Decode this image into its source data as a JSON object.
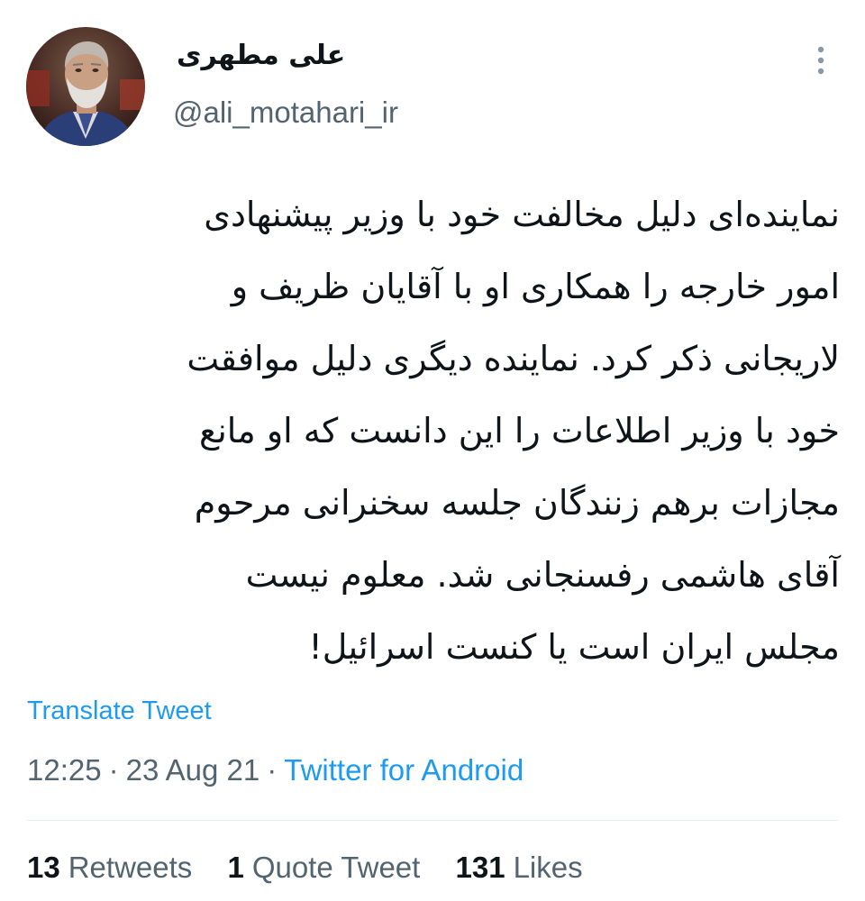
{
  "colors": {
    "link": "#1d9bf0",
    "secondary_text": "#536471",
    "primary_text": "#0f1419",
    "divider": "#e6ecf0"
  },
  "author": {
    "display_name": "علی مطهری",
    "handle": "@ali_motahari_ir",
    "avatar_icon": "profile-photo"
  },
  "menu": {
    "icon": "more-vertical-icon"
  },
  "tweet": {
    "lines": [
      "نماینده‌ای دلیل مخالفت خود با وزیر پیشنهادی",
      "امور خارجه را همکاری او با آقایان ظریف و",
      "لاریجانی ذکر کرد. نماینده دیگری دلیل موافقت",
      "خود با وزیر اطلاعات را این دانست که او مانع",
      "مجازات برهم زنندگان جلسه سخنرانی مرحوم",
      "آقای هاشمی رفسنجانی شد. معلوم نیست",
      "مجلس ایران است یا کنست اسرائیل!"
    ],
    "translate_label": "Translate Tweet",
    "time": "12:25",
    "separator": "·",
    "date": "23 Aug 21",
    "source": "Twitter for Android"
  },
  "stats": [
    {
      "count": "13",
      "label": "Retweets"
    },
    {
      "count": "1",
      "label": "Quote Tweet"
    },
    {
      "count": "131",
      "label": "Likes"
    }
  ]
}
